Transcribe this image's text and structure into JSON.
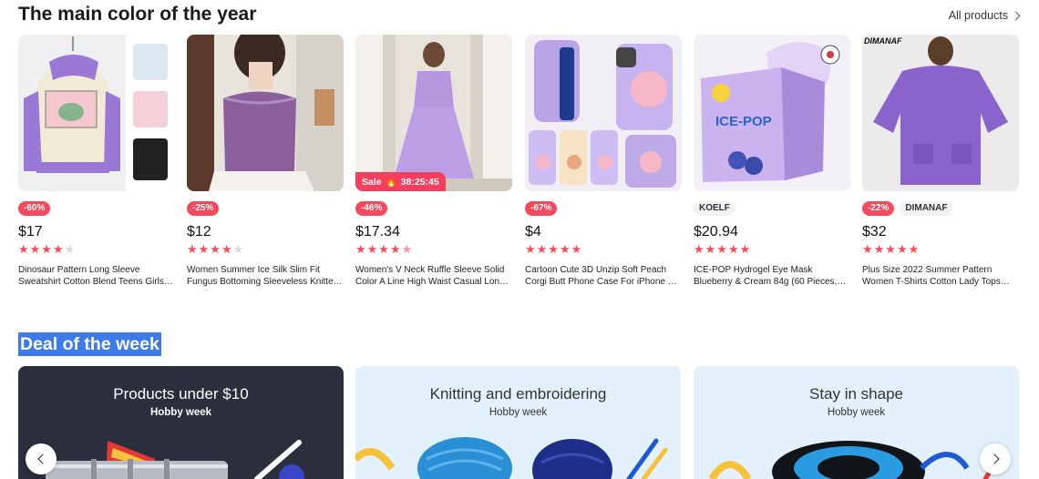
{
  "header": {
    "title": "The main color of the year",
    "all_products": "All products",
    "all_products_icon": "chevron-right-icon"
  },
  "products": [
    {
      "discount": "-60%",
      "brand": "",
      "price": "$17",
      "rating": 4,
      "rating_display": "4 of 5 stars",
      "title_line1": "Dinosaur Pattern Long Sleeve",
      "title_line2": "Sweatshirt Cotton Blend Teens Girls…"
    },
    {
      "discount": "-25%",
      "brand": "",
      "price": "$12",
      "rating": 4,
      "rating_display": "4 of 5 stars",
      "title_line1": "Women Summer Ice Silk Slim Fit",
      "title_line2": "Fungus Bottoming Sleeveless Knitte…"
    },
    {
      "discount": "-46%",
      "brand": "",
      "price": "$17.34",
      "rating": 4.5,
      "rating_display": "4.5 of 5 stars",
      "title_line1": "Women's V Neck Ruffle Sleeve Solid",
      "title_line2": "Color A Line High Waist Casual Lon…",
      "sale_label": "Sale",
      "sale_timer": "38:25:45"
    },
    {
      "discount": "-67%",
      "brand": "",
      "price": "$4",
      "rating": 5,
      "rating_display": "5 of 5 stars",
      "title_line1": "Cartoon Cute 3D Unzip Soft Peach",
      "title_line2": "Corgi Butt Phone Case For iPhone 1…"
    },
    {
      "discount": "",
      "brand": "KOELF",
      "price": "$20.94",
      "rating": 5,
      "rating_display": "5 of 5 stars",
      "title_line1": "ICE-POP Hydrogel Eye Mask",
      "title_line2": "Blueberry & Cream 84g (60 Pieces,…",
      "image_text": "ICE-POP"
    },
    {
      "discount": "-22%",
      "brand": "DIMANAF",
      "price": "$32",
      "rating": 5,
      "rating_display": "5 of 5 stars",
      "title_line1": "Plus Size 2022 Summer Pattern",
      "title_line2": "Women T-Shirts Cotton Lady Tops…",
      "image_text": "DIMANAF"
    }
  ],
  "deal": {
    "title": "Deal of the week",
    "cards": [
      {
        "title": "Products under $10",
        "subtitle": "Hobby week",
        "bg": "#2b2e3c",
        "fg": "#ffffff"
      },
      {
        "title": "Knitting and embroidering",
        "subtitle": "Hobby week",
        "bg": "#e3f1fc",
        "fg": "#333333"
      },
      {
        "title": "Stay in shape",
        "subtitle": "Hobby week",
        "bg": "#e3f1fc",
        "fg": "#333333"
      }
    ],
    "prev_icon": "chevron-left-icon",
    "next_icon": "chevron-right-icon"
  },
  "colors": {
    "accent": "#f14d5d",
    "purple": "#9b79d9",
    "selection": "#3d7ce8"
  }
}
